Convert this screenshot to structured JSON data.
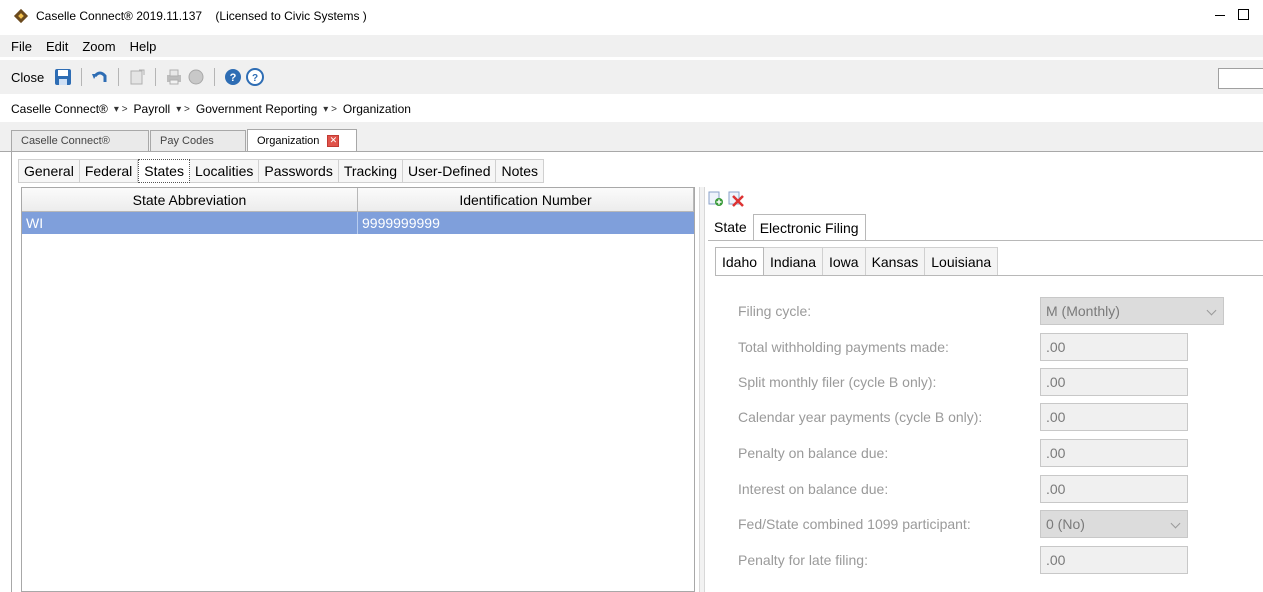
{
  "window": {
    "title": "Caselle Connect® 2019.11.137    (Licensed to Civic Systems )"
  },
  "menu": [
    "File",
    "Edit",
    "Zoom",
    "Help"
  ],
  "toolbar": {
    "close_label": "Close"
  },
  "breadcrumb": [
    "Caselle Connect®",
    "Payroll",
    "Government Reporting",
    "Organization"
  ],
  "doc_tabs": [
    "Caselle Connect®",
    "Pay Codes",
    "Organization"
  ],
  "sub_tabs": [
    "General",
    "Federal",
    "States",
    "Localities",
    "Passwords",
    "Tracking",
    "User-Defined",
    "Notes"
  ],
  "grid": {
    "columns": [
      "State Abbreviation",
      "Identification Number"
    ],
    "rows": [
      [
        "WI",
        "9999999999"
      ]
    ]
  },
  "right_panel": {
    "tabs": [
      "State",
      "Electronic Filing"
    ],
    "state_tabs": [
      "Idaho",
      "Indiana",
      "Iowa",
      "Kansas",
      "Louisiana"
    ],
    "form": {
      "filing_cycle_label": "Filing cycle:",
      "filing_cycle_value": "M (Monthly)",
      "total_withholding_label": "Total withholding payments made:",
      "total_withholding_value": ".00",
      "split_monthly_label": "Split monthly filer (cycle B only):",
      "split_monthly_value": ".00",
      "calendar_year_label": "Calendar year payments (cycle B only):",
      "calendar_year_value": ".00",
      "penalty_balance_label": "Penalty on balance due:",
      "penalty_balance_value": ".00",
      "interest_balance_label": "Interest on balance due:",
      "interest_balance_value": ".00",
      "fed_state_label": "Fed/State combined 1099 participant:",
      "fed_state_value": "0 (No)",
      "penalty_late_label": "Penalty for late filing:",
      "penalty_late_value": ".00"
    }
  },
  "colors": {
    "selected_row": "#7f9fdb",
    "chrome_bg": "#f0f0f0"
  }
}
